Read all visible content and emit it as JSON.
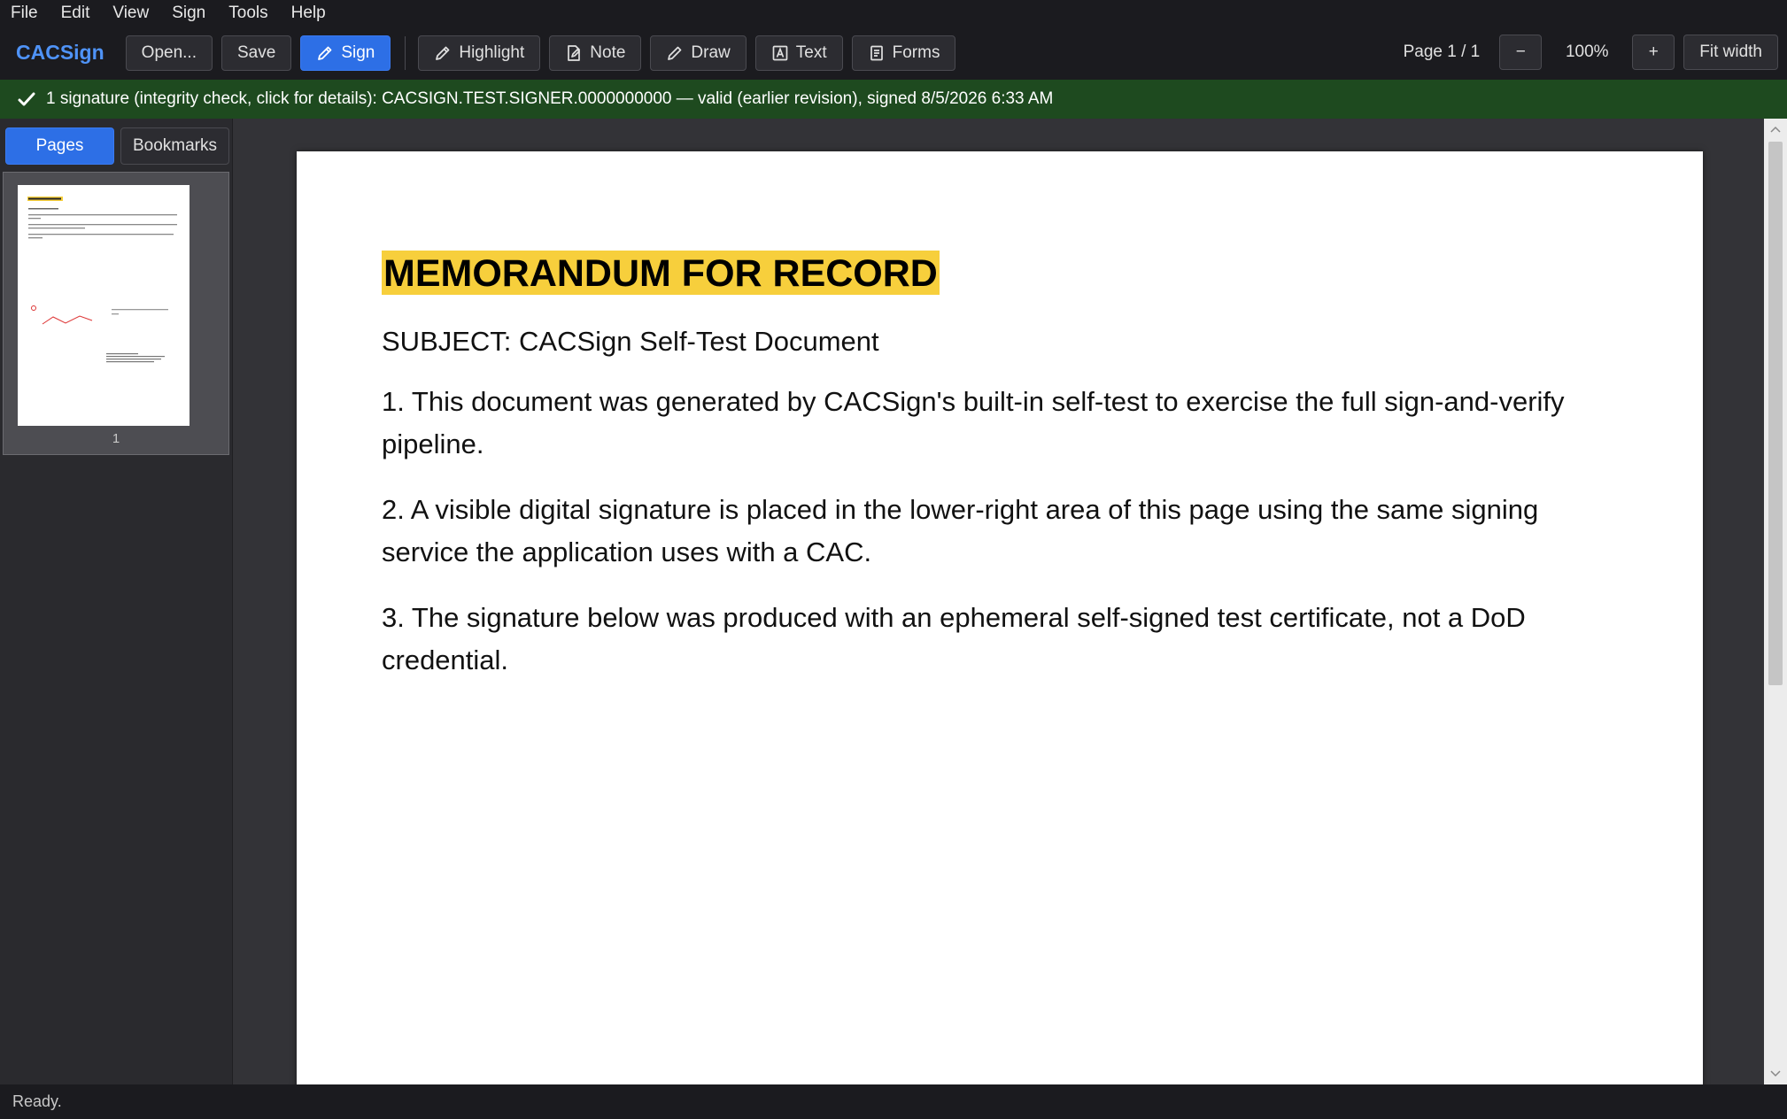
{
  "menu": [
    "File",
    "Edit",
    "View",
    "Sign",
    "Tools",
    "Help"
  ],
  "toolbar": {
    "brand": "CACSign",
    "open": "Open...",
    "save": "Save",
    "sign": "Sign",
    "highlight": "Highlight",
    "note": "Note",
    "draw": "Draw",
    "text": "Text",
    "forms": "Forms",
    "page_indicator": "Page 1 / 1",
    "zoom_out": "−",
    "zoom_level": "100%",
    "zoom_in": "+",
    "fit_width": "Fit width"
  },
  "signature_bar": {
    "text": "1 signature (integrity check, click for details): CACSIGN.TEST.SIGNER.0000000000 — valid (earlier revision), signed 8/5/2026 6:33 AM",
    "color": "#1e4a1f"
  },
  "sidebar": {
    "tabs": [
      "Pages",
      "Bookmarks"
    ],
    "active_tab": "Pages",
    "thumbnails": [
      {
        "page_number": "1"
      }
    ]
  },
  "document": {
    "title": "MEMORANDUM FOR RECORD",
    "subject": "SUBJECT: CACSign Self-Test Document",
    "paragraphs": [
      "1. This document was generated by CACSign's built-in self-test to exercise the full sign-and-verify pipeline.",
      "2. A visible digital signature is placed in the lower-right area of this page using the same signing service the application uses with a CAC.",
      "3. The signature below was produced with an ephemeral self-signed test certificate, not a DoD credential."
    ],
    "highlight_color": "#f7cf3c"
  },
  "status": "Ready.",
  "colors": {
    "accent": "#2d6fe6",
    "brand": "#4f93f7"
  }
}
